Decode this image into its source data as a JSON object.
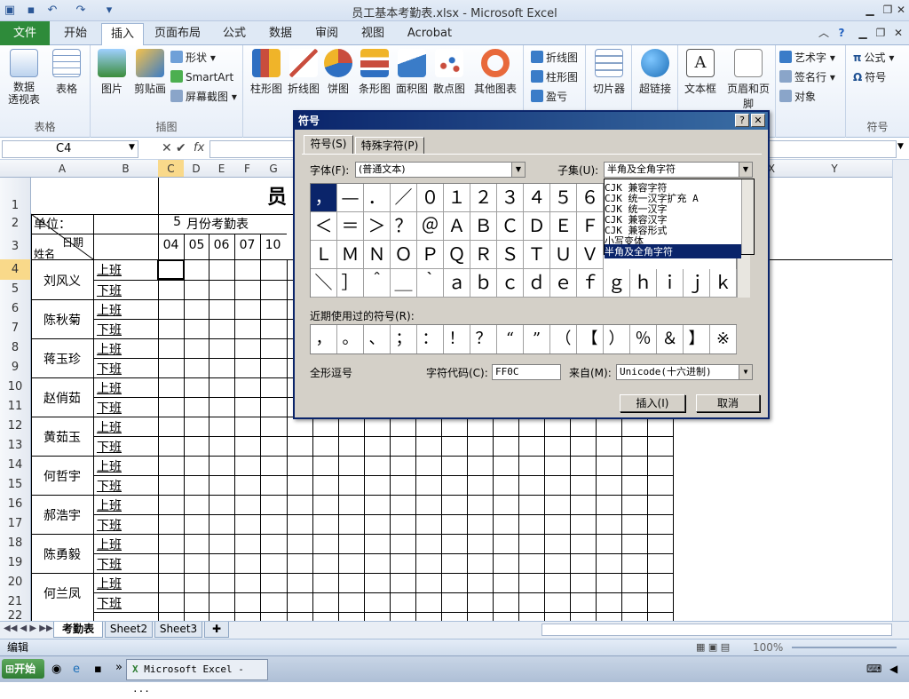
{
  "window": {
    "title": "员工基本考勤表.xlsx - Microsoft Excel"
  },
  "ribbon_tabs": [
    {
      "label": "文件"
    },
    {
      "label": "开始"
    },
    {
      "label": "插入"
    },
    {
      "label": "页面布局"
    },
    {
      "label": "公式"
    },
    {
      "label": "数据"
    },
    {
      "label": "审阅"
    },
    {
      "label": "视图"
    },
    {
      "label": "Acrobat"
    }
  ],
  "ribbon": {
    "groups": {
      "table": "表格",
      "illus": "插图",
      "symbol": "符号"
    },
    "pivot": "数据\n透视表",
    "table": "表格",
    "picture": "图片",
    "clipart": "剪贴画",
    "shapes": "形状",
    "smartart": "SmartArt",
    "screenshot": "屏幕截图",
    "charts": [
      "柱形图",
      "折线图",
      "饼图",
      "条形图",
      "面积图",
      "散点图",
      "其他图表"
    ],
    "spark": [
      "折线图",
      "柱形图",
      "盈亏"
    ],
    "slicer": "切片器",
    "hyperlink": "超链接",
    "textbox": "文本框",
    "header": "页眉和页脚",
    "wordart": "艺术字",
    "signature": "签名行",
    "object": "对象",
    "equation": "公式",
    "symbol": "符号"
  },
  "formula": {
    "namebox": "C4",
    "fx": "fx"
  },
  "columns": [
    "A",
    "B",
    "C",
    "D",
    "E",
    "F",
    "G",
    "X",
    "Y"
  ],
  "rows": [
    "1",
    "2",
    "3",
    "4",
    "5",
    "6",
    "7",
    "8",
    "9",
    "10",
    "11",
    "12",
    "13",
    "14",
    "15",
    "16",
    "17",
    "18",
    "19",
    "20",
    "21",
    "22"
  ],
  "sheet": {
    "title_char": "员",
    "unit": "单位：",
    "month_num": "5",
    "month_label": "月份考勤表",
    "date_label": "日期",
    "name_label": "姓名",
    "days": [
      "04",
      "05",
      "06",
      "07",
      "10"
    ],
    "employees": [
      "刘风义",
      "陈秋菊",
      "蒋玉珍",
      "赵俏茹",
      "黄茹玉",
      "何哲宇",
      "郝浩宇",
      "陈勇毅",
      "何兰凤"
    ],
    "shift_am": "上班",
    "shift_pm": "下班"
  },
  "sheet_tabs": [
    "考勤表",
    "Sheet2",
    "Sheet3"
  ],
  "status": {
    "mode": "编辑",
    "zoom": "100%"
  },
  "taskbar": {
    "start": "开始",
    "app": "Microsoft Excel - ..."
  },
  "dialog": {
    "title": "符号",
    "help": "?",
    "close": "✕",
    "tabs": [
      "符号(S)",
      "特殊字符(P)"
    ],
    "font_label": "字体(F):",
    "font_value": "(普通文本)",
    "subset_label": "子集(U):",
    "subset_value": "半角及全角字符",
    "subset_options": [
      "CJK 兼容字符",
      "CJK 统一汉字扩充 A",
      "CJK 统一汉字",
      "CJK 兼容汉字",
      "CJK 兼容形式",
      "小写变体",
      "半角及全角字符"
    ],
    "symbols": [
      "，",
      "—",
      "．",
      "／",
      "０",
      "１",
      "２",
      "３",
      "４",
      "５",
      "６",
      "＜",
      "＝",
      "＞",
      "？",
      "＠",
      "Ａ",
      "Ｂ",
      "Ｃ",
      "Ｄ",
      "Ｅ",
      "Ｆ",
      "Ｌ",
      "Ｍ",
      "Ｎ",
      "Ｏ",
      "Ｐ",
      "Ｑ",
      "Ｒ",
      "Ｓ",
      "Ｔ",
      "Ｕ",
      "Ｖ",
      "＼",
      "］",
      "＾",
      "＿",
      "｀",
      "ａ",
      "ｂ",
      "ｃ",
      "ｄ",
      "ｅ",
      "ｆ",
      "ｇ",
      "ｈ",
      "ｉ",
      "ｊ",
      "ｋ"
    ],
    "recent_label": "近期使用过的符号(R):",
    "recent": [
      "，",
      "。",
      "、",
      "；",
      "：",
      "！",
      "？",
      "“",
      "”",
      "（",
      "【",
      "）",
      "％",
      "＆",
      "】",
      "※"
    ],
    "char_name": "全形逗号",
    "code_label": "字符代码(C):",
    "code_value": "FF0C",
    "from_label": "来自(M):",
    "from_value": "Unicode(十六进制)",
    "insert": "插入(I)",
    "cancel": "取消"
  }
}
